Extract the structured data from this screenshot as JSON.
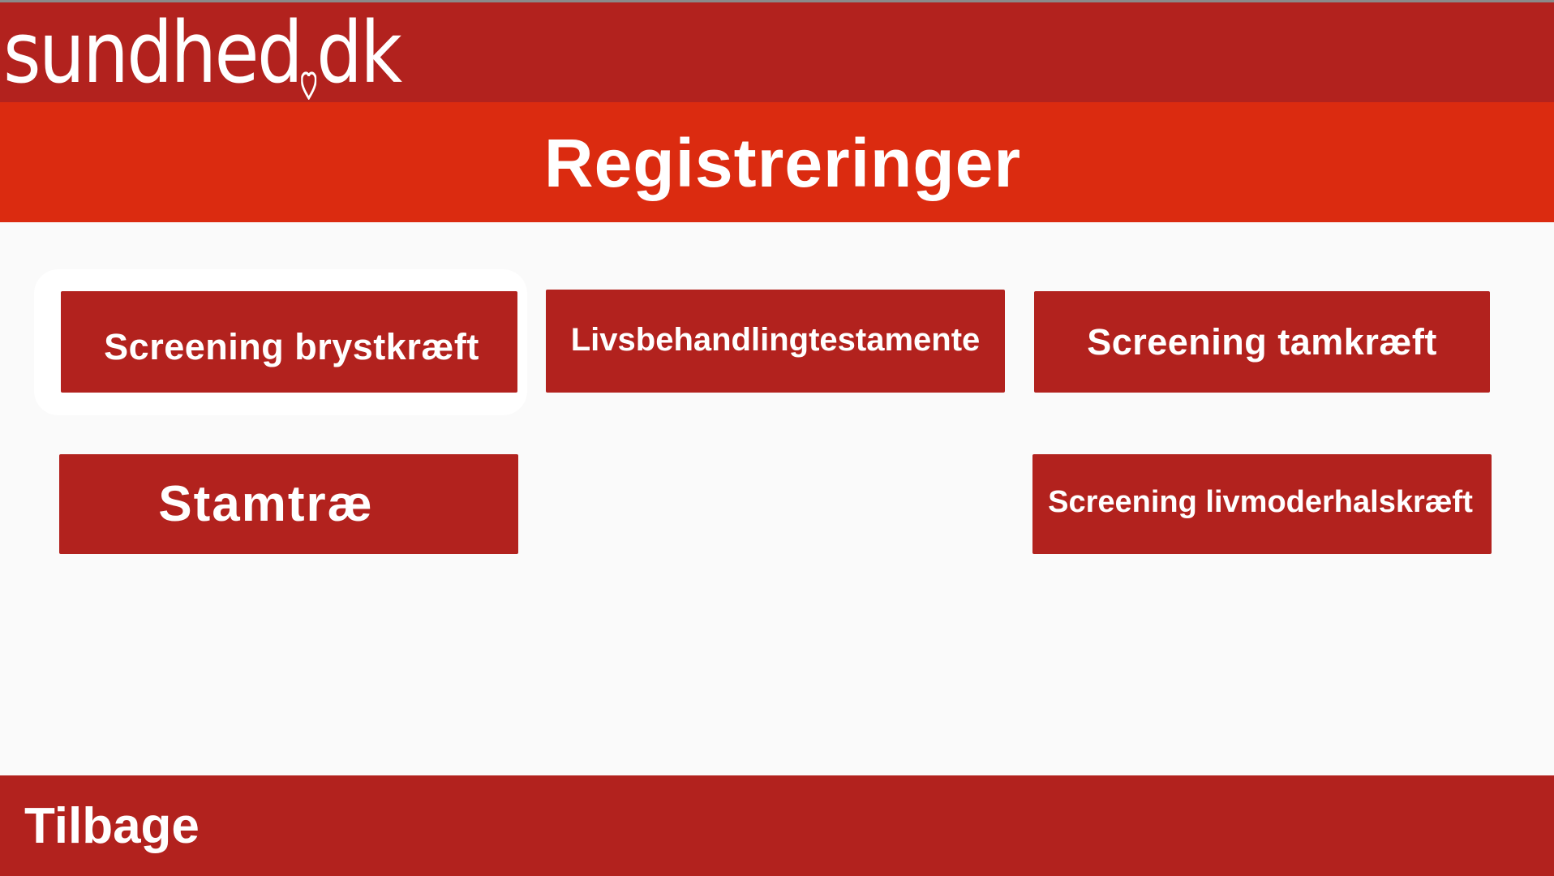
{
  "brand": {
    "logo_text": "sundhed.dk",
    "logo_left": "sundhed",
    "logo_right": "dk",
    "bar_color": "#b2221e"
  },
  "header": {
    "title": "Registreringer",
    "bar_color": "#db2b10"
  },
  "tiles": [
    {
      "label": "Screening brystkræft",
      "focused": true
    },
    {
      "label": "Livsbehandlingtestamente",
      "focused": false
    },
    {
      "label": "Screening tamkræft",
      "focused": false
    },
    {
      "label": "Stamtræ",
      "focused": false
    },
    {
      "label": "Screening livmoderhalskræft",
      "focused": false
    }
  ],
  "footer": {
    "back_label": "Tilbage"
  },
  "colors": {
    "tile": "#b2221e",
    "background": "#fafafa",
    "text": "#ffffff"
  },
  "icons": {
    "logo_heart": "heart-icon"
  }
}
